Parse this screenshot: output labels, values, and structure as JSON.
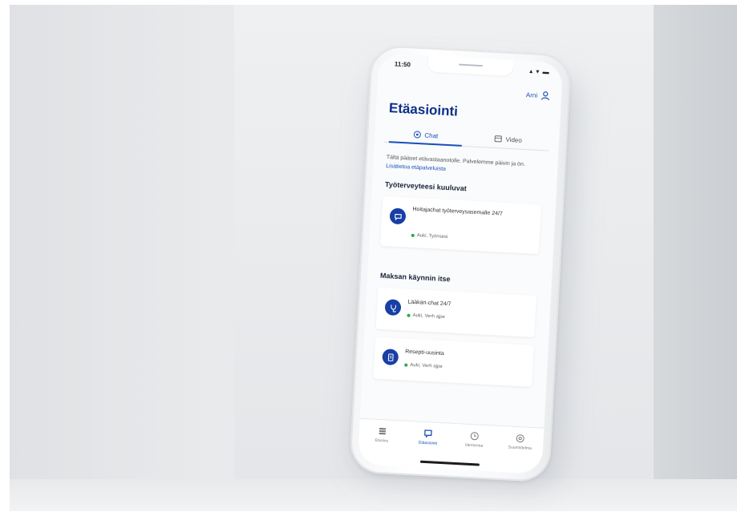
{
  "status_bar": {
    "time": "11:50",
    "icons": "▴ ▾ ▬"
  },
  "header": {
    "user_label": "Arni",
    "title": "Etäasiointi"
  },
  "tabs": [
    {
      "label": "Chat",
      "icon": "chat-icon",
      "active": true
    },
    {
      "label": "Video",
      "icon": "video-icon",
      "active": false
    }
  ],
  "intro": {
    "text": "Tältä pääset etävastaanotolle. Palvelemme päivin ja ön.",
    "link": "Lisätietoa etäpalveluista"
  },
  "sections": [
    {
      "title": "Työterveyteesi kuuluvat",
      "cards": [
        {
          "title": "Hoitajachat työterveysasemalle 24/7",
          "status": "Auki, Työnsesi",
          "icon": "chat-bubble-icon"
        }
      ]
    },
    {
      "title": "Maksan käynnin itse",
      "cards": [
        {
          "title": "Lääkäri-chat 24/7",
          "status": "Auki, Verh ajpe",
          "icon": "stethoscope-icon"
        },
        {
          "title": "Resepti-uusinta",
          "status": "Auki, Verh ajpe",
          "icon": "document-icon"
        }
      ]
    }
  ],
  "tabbar": [
    {
      "label": "Etusivu",
      "icon": "home-icon",
      "active": false
    },
    {
      "label": "Etäasiointi",
      "icon": "chat-icon",
      "active": true
    },
    {
      "label": "Varmenna",
      "icon": "clock-icon",
      "active": false
    },
    {
      "label": "Suunnittelma",
      "icon": "globe-icon",
      "active": false
    }
  ],
  "colors": {
    "brand_blue": "#0b2f88",
    "accent_blue": "#1a4fb8",
    "status_green": "#2aa84a"
  }
}
